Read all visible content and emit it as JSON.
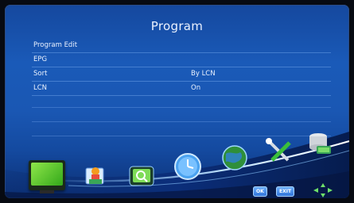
{
  "screen": {
    "title": "Program"
  },
  "menu": {
    "items": [
      {
        "label": "Program Edit",
        "value": ""
      },
      {
        "label": "EPG",
        "value": ""
      },
      {
        "label": "Sort",
        "value": "By LCN"
      },
      {
        "label": "LCN",
        "value": "On"
      }
    ]
  },
  "footer": {
    "ok_label": "OK",
    "exit_label": "EXIT"
  },
  "icons": [
    "tv-icon",
    "media-icon",
    "search-icon",
    "clock-icon",
    "globe-icon",
    "tools-icon",
    "storage-icon",
    "direction-arrows-icon"
  ],
  "colors": {
    "background": "#1a57b3",
    "text": "#eaf2ff",
    "accent": "#6fb3ff"
  }
}
